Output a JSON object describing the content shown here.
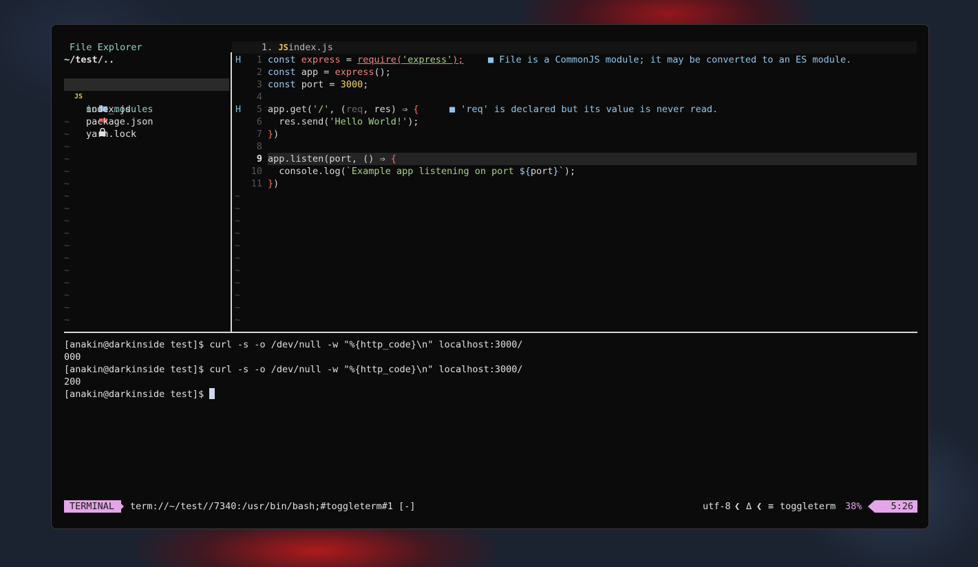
{
  "explorer": {
    "title": "File Explorer",
    "path": "~/test/..",
    "items": [
      {
        "name": "node_modules",
        "icon": "folder-icon",
        "chevron": "›"
      },
      {
        "name": "index.js",
        "icon": "JS"
      },
      {
        "name": "package.json",
        "icon": "npm-icon"
      },
      {
        "name": "yarn.lock",
        "icon": "lock-icon"
      }
    ],
    "empty_marker": "~"
  },
  "editor": {
    "tab_index": "1.",
    "tab_icon": "JS",
    "tab_name": "index.js",
    "sign_hint": "H",
    "line_numbers": [
      "1",
      "2",
      "3",
      "4",
      "5",
      "6",
      "7",
      "8",
      "9",
      "10",
      "11"
    ],
    "lines": {
      "l1_kw": "const ",
      "l1_var": "express",
      "l1_eq": " = ",
      "l1_fn": "require",
      "l1_p1": "(",
      "l1_str": "'express'",
      "l1_p2": ");",
      "l2_kw": "const ",
      "l2_var": "app = ",
      "l2_fn": "express",
      "l2_rest": "();",
      "l3_kw": "const ",
      "l3_var": "port = ",
      "l3_num": "3000",
      "l3_rest": ";",
      "l5_a": "app.get(",
      "l5_str": "'/'",
      "l5_b": ", (",
      "l5_req": "req",
      "l5_c": ", res) ⇒ ",
      "l5_br": "{",
      "l6_a": "  res.send(",
      "l6_str": "'Hello World!'",
      "l6_b": ");",
      "l7_br": "}",
      "l7_rest": ")",
      "l9_a": "app.listen(port, () ⇒ ",
      "l9_br": "{",
      "l10_a": "  console.log(",
      "l10_str": "`Example app listening on port ",
      "l10_tpl": "${",
      "l10_var": "port",
      "l10_tpl2": "}",
      "l10_str2": "`",
      "l10_b": ");",
      "l11_br": "}",
      "l11_rest": ")"
    },
    "diagnostics": {
      "d1": "■ File is a CommonJS module; it may be converted to an ES module.",
      "d2": "■ 'req' is declared but its value is never read."
    },
    "empty_marker": "~"
  },
  "terminal": {
    "lines": [
      "[anakin@darkinside test]$ curl -s -o /dev/null -w \"%{http_code}\\n\" localhost:3000/",
      "000",
      "[anakin@darkinside test]$ curl -s -o /dev/null -w \"%{http_code}\\n\" localhost:3000/",
      "200"
    ],
    "prompt": "[anakin@darkinside test]$ "
  },
  "statusline": {
    "mode": "TERMINAL",
    "path": "term://~/test//7340:/usr/bin/bash;#toggleterm#1 [-]",
    "encoding": "utf-8",
    "sep": "❮",
    "os_icon": "Δ",
    "ft_icon": "≡",
    "filetype": "toggleterm",
    "percent": "38%",
    "position": "5:26"
  },
  "colors": {
    "mode_bg": "#e3a6e8",
    "keyword": "#9ec9f5",
    "function": "#f08080",
    "string": "#a6d189",
    "number": "#f5d76e",
    "diagnostic": "#8ec7ee"
  }
}
